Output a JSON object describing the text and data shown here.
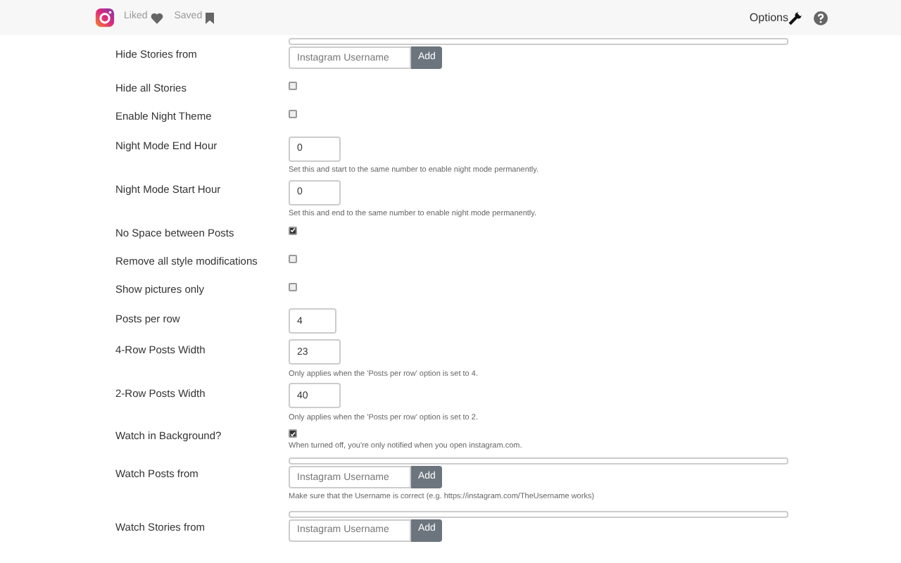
{
  "header": {
    "nav": [
      {
        "label": "Liked",
        "kind": "heart"
      },
      {
        "label": "Saved",
        "kind": "bookmark"
      }
    ],
    "options": "Options"
  },
  "settings": [
    {
      "kind": "list",
      "label": "Hide Stories from",
      "placeholder": "Instagram Username",
      "button": "Add"
    },
    {
      "kind": "checkbox",
      "label": "Hide all Stories",
      "checked": false
    },
    {
      "kind": "checkbox",
      "label": "Enable Night Theme",
      "checked": false
    },
    {
      "kind": "number",
      "label": "Night Mode End Hour",
      "value": "0",
      "help": "Set this and start to the same number to enable night mode permanently."
    },
    {
      "kind": "number",
      "label": "Night Mode Start Hour",
      "value": "0",
      "help": "Set this and end to the same number to enable night mode permanently."
    },
    {
      "kind": "checkbox",
      "label": "No Space between Posts",
      "checked": true
    },
    {
      "kind": "checkbox",
      "label": "Remove all style modifications",
      "checked": false
    },
    {
      "kind": "checkbox",
      "label": "Show pictures only",
      "checked": false
    },
    {
      "kind": "number",
      "label": "Posts per row",
      "value": "4"
    },
    {
      "kind": "number",
      "label": "4-Row Posts Width",
      "value": "23",
      "help": "Only applies when the 'Posts per row' option is set to 4."
    },
    {
      "kind": "number",
      "label": "2-Row Posts Width",
      "value": "40",
      "help": "Only applies when the 'Posts per row' option is set to 2."
    },
    {
      "kind": "checkbox",
      "label": "Watch in Background?",
      "checked": true,
      "help": "When turned off, you're only notified when you open instagram.com."
    },
    {
      "kind": "list",
      "label": "Watch Posts from",
      "placeholder": "Instagram Username",
      "button": "Add",
      "help": "Make sure that the Username is correct (e.g. https://instagram.com/TheUsername works)"
    },
    {
      "kind": "list",
      "label": "Watch Stories from",
      "placeholder": "Instagram Username",
      "button": "Add"
    }
  ]
}
